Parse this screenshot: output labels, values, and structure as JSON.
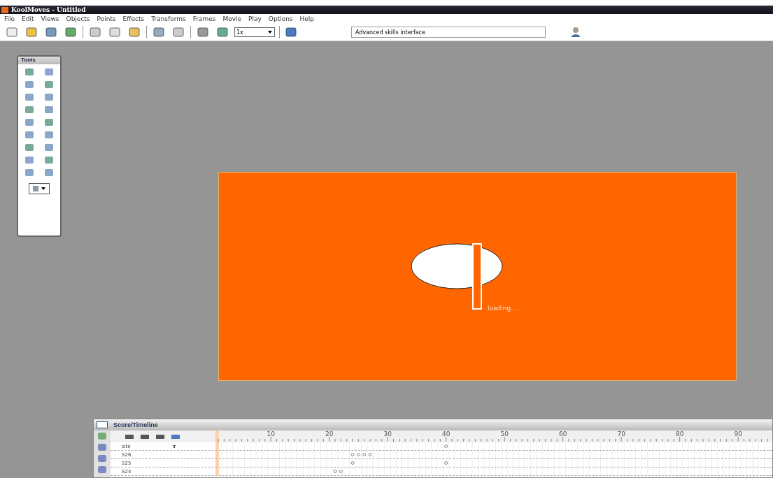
{
  "window": {
    "title": "KoolMoves - Untitled"
  },
  "menu": [
    "File",
    "Edit",
    "Views",
    "Objects",
    "Points",
    "Effects",
    "Transforms",
    "Frames",
    "Movie",
    "Play",
    "Options",
    "Help"
  ],
  "toolbar": {
    "zoom": "1x",
    "mode": "Advanced skills interface"
  },
  "tools_panel": {
    "title": "Tools"
  },
  "stage": {
    "caption": "loading ..."
  },
  "timeline": {
    "title": "Score/Timeline",
    "ruler": [
      "10",
      "20",
      "30",
      "40",
      "50",
      "60",
      "70",
      "80",
      "90"
    ],
    "rows": [
      {
        "name": "site",
        "type_mark": "T"
      },
      {
        "name": "S26"
      },
      {
        "name": "S25"
      },
      {
        "name": "S24"
      }
    ]
  }
}
